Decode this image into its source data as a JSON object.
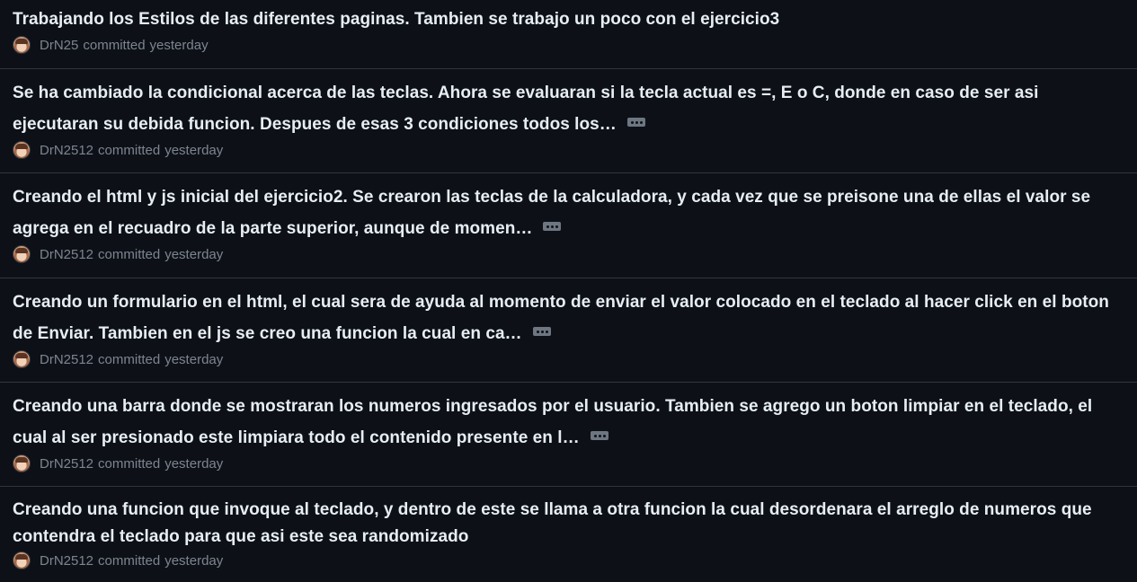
{
  "commits": [
    {
      "message": "Trabajando los Estilos de las diferentes paginas. Tambien se trabajo un poco con el ejercicio3",
      "author": "DrN25",
      "action": "committed",
      "time": "yesterday",
      "truncated": false
    },
    {
      "message": "Se ha cambiado la condicional acerca de las teclas. Ahora se evaluaran si la tecla actual es =, E o C, donde en caso de ser asi ejecutaran su debida funcion. Despues de esas 3 condiciones todos los…",
      "author": "DrN2512",
      "action": "committed",
      "time": "yesterday",
      "truncated": true
    },
    {
      "message": "Creando el html y js inicial del ejercicio2. Se crearon las teclas de la calculadora, y cada vez que se preisone una de ellas el valor se agrega en el recuadro de la parte superior, aunque de momen…",
      "author": "DrN2512",
      "action": "committed",
      "time": "yesterday",
      "truncated": true
    },
    {
      "message": "Creando un formulario en el html, el cual sera de ayuda al momento de enviar el valor colocado en el teclado al hacer click en el boton de Enviar. Tambien en el js se creo una funcion la cual en ca…",
      "author": "DrN2512",
      "action": "committed",
      "time": "yesterday",
      "truncated": true
    },
    {
      "message": "Creando una barra donde se mostraran los numeros ingresados por el usuario. Tambien se agrego un boton limpiar en el teclado, el cual al ser presionado este limpiara todo el contenido presente en l…",
      "author": "DrN2512",
      "action": "committed",
      "time": "yesterday",
      "truncated": true
    },
    {
      "message": "Creando una funcion que invoque al teclado, y dentro de este se llama a otra funcion la cual desordenara el arreglo de numeros que contendra el teclado para que asi este sea randomizado",
      "author": "DrN2512",
      "action": "committed",
      "time": "yesterday",
      "truncated": false
    }
  ],
  "colors": {
    "background": "#0d1117",
    "text_primary": "#e6edf3",
    "text_muted": "#7d8590",
    "divider": "#30363d"
  },
  "icons": {
    "ellipsis": "kebab-horizontal-icon",
    "avatar": "user-avatar"
  }
}
